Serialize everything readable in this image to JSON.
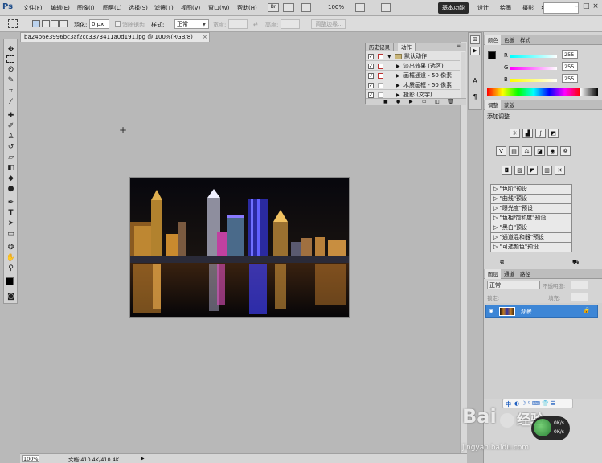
{
  "app": {
    "logo": "Ps"
  },
  "menu": [
    "文件(F)",
    "编辑(E)",
    "图像(I)",
    "图层(L)",
    "选择(S)",
    "滤镜(T)",
    "视图(V)",
    "窗口(W)",
    "帮助(H)"
  ],
  "menubar_zoom": "100%",
  "workspaces": {
    "active": "基本功能",
    "others": [
      "设计",
      "绘画",
      "摄影"
    ],
    "more": "»"
  },
  "window_controls": {
    "min": "–",
    "max": "□",
    "close": "×"
  },
  "options": {
    "feather_label": "羽化:",
    "feather_value": "0 px",
    "antialias_label": "消除锯齿",
    "style_label": "样式:",
    "style_value": "正常",
    "width_label": "宽度:",
    "height_label": "高度:",
    "refine_edge": "调整边缘..."
  },
  "document": {
    "tab_title": "ba24b6e3996bc3af2cc3373411a0d191.jpg @ 100%(RGB/8)",
    "tab_close": "×",
    "zoom": "100%",
    "doc_info": "文档:410.4K/410.4K"
  },
  "actions_panel": {
    "tabs": [
      "历史记录",
      "动作"
    ],
    "rows": [
      {
        "check": "✓",
        "label": "默认动作",
        "folder": true
      },
      {
        "check": "✓",
        "label": "淡出效果 (选区)"
      },
      {
        "check": "✓",
        "label": "画框通道 - 50 像素"
      },
      {
        "check": "✓",
        "label": "木质画框 - 50 像素"
      },
      {
        "check": "✓",
        "label": "投影 (文字)"
      }
    ]
  },
  "color_panel": {
    "tabs": [
      "颜色",
      "色板",
      "样式"
    ],
    "r_label": "R",
    "g_label": "G",
    "b_label": "B",
    "r": "255",
    "g": "255",
    "b": "255"
  },
  "adjustments_panel": {
    "tabs": [
      "调整",
      "蒙版"
    ],
    "title": "添加调整",
    "presets": [
      "\"色阶\"预设",
      "\"曲线\"预设",
      "\"曝光度\"预设",
      "\"色相/饱和度\"预设",
      "\"黑白\"预设",
      "\"通道混和器\"预设",
      "\"可选颜色\"预设"
    ]
  },
  "layers_panel": {
    "tabs": [
      "图层",
      "通道",
      "路径"
    ],
    "blend_mode": "正常",
    "opacity_label": "不透明度:",
    "lock_label": "锁定:",
    "fill_label": "填充:",
    "layer_name": "背景"
  },
  "watermark": {
    "brand": "Bai",
    "brand2": "经验",
    "url": "jingyan.baidu.com",
    "toolbar_label": "中",
    "speed_value": "0K/s"
  },
  "colors": {
    "accent": "#3d86d6",
    "ws_active": "#2a2a2a"
  }
}
